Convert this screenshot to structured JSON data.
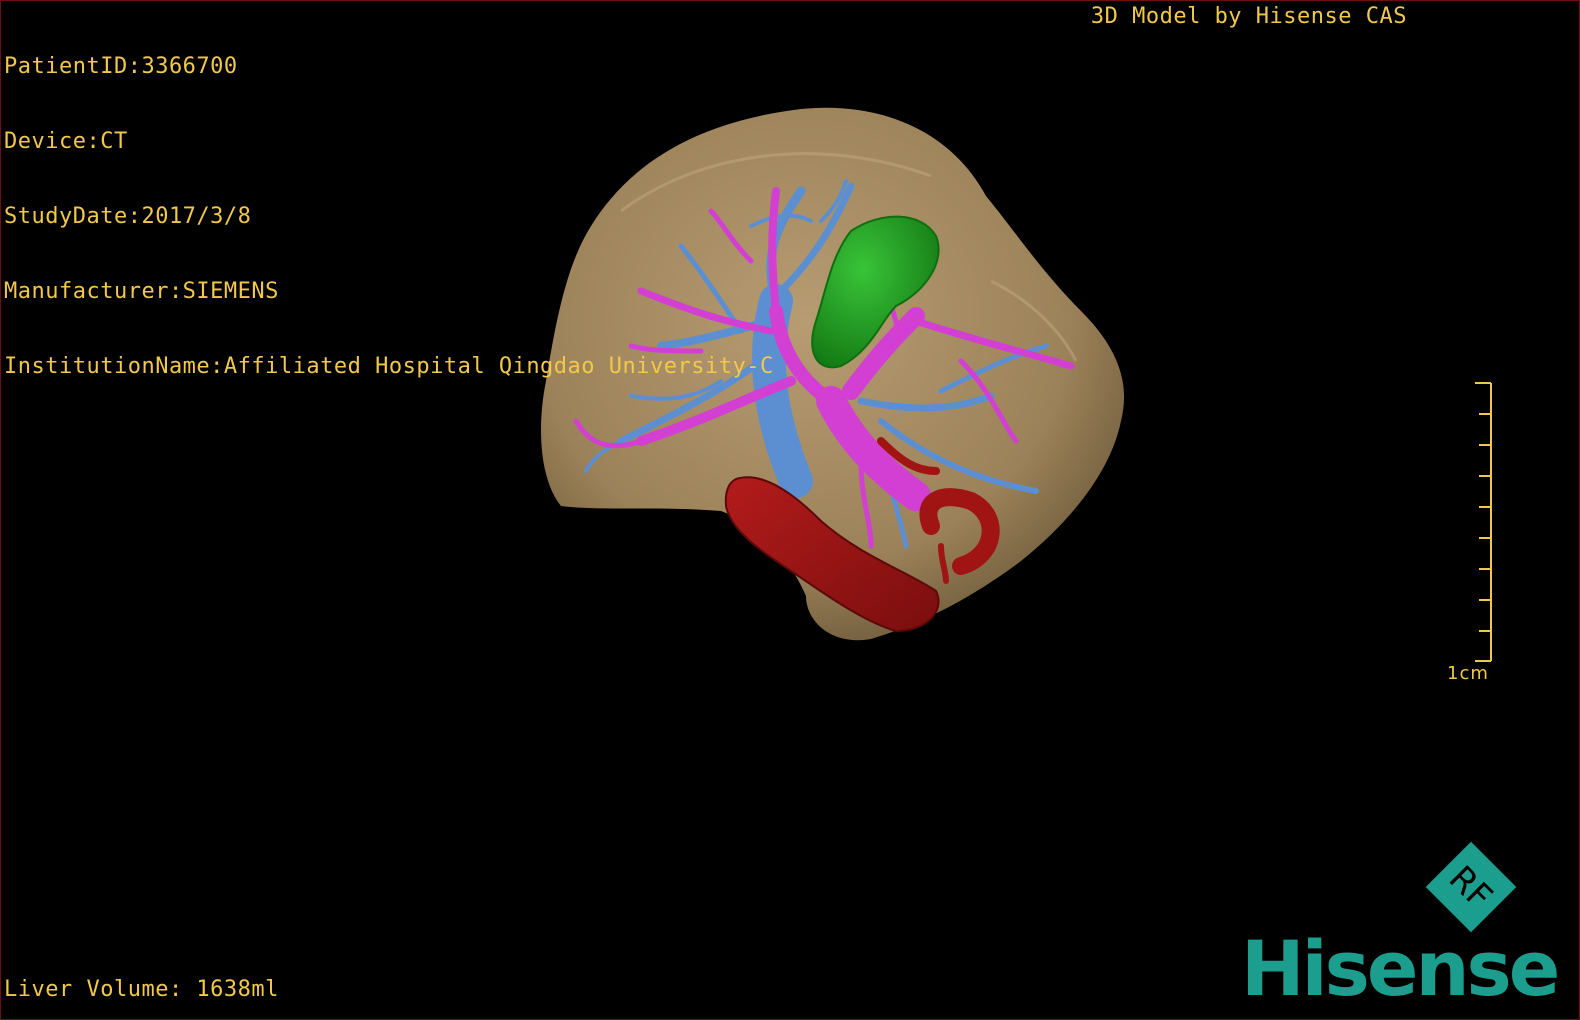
{
  "info": {
    "patient_id": "PatientID:3366700",
    "device": "Device:CT",
    "study_date": "StudyDate:2017/3/8",
    "manufacturer": "Manufacturer:SIEMENS",
    "institution": "InstitutionName:Affiliated Hospital Qingdao University-C"
  },
  "caption": "3D Model by Hisense CAS",
  "volume": "Liver Volume: 1638ml",
  "scale": {
    "label": "1cm",
    "ticks": 10
  },
  "logo": {
    "rf_text": "RF",
    "brand": "Hisense",
    "brand_color": "#1b9e8e"
  },
  "colors": {
    "text": "#f2c84b",
    "liver": "#a58b63",
    "gallbladder": "#1ea21e",
    "portal_vein": "#d23fd2",
    "hepatic_vein": "#5c8fd1",
    "artery": "#a01414"
  }
}
